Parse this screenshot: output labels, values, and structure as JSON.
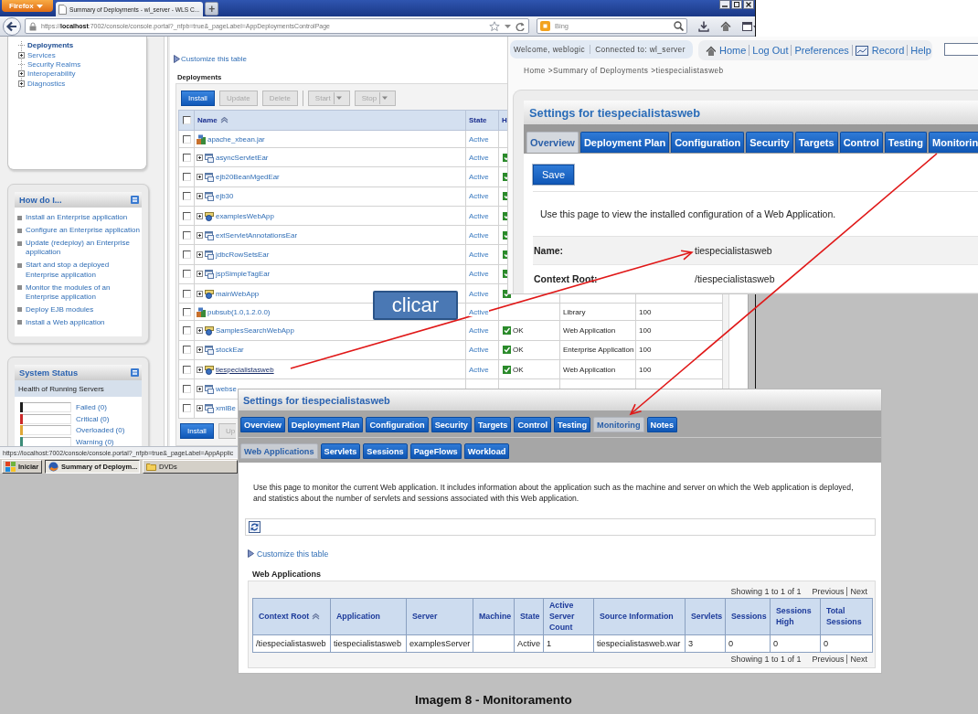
{
  "browser": {
    "menu_button": "Firefox",
    "tab_title": "Summary of Deployments - wl_server - WLS C...",
    "new_tab": "+",
    "url": "https://**localhost**:7002/console/console.portal?_nfpb=true&_pageLabel=AppDeploymentsControlPage",
    "search_placeholder": "Bing",
    "status_url": "https://localhost:7002/console/console.portal?_nfpb=true&_pageLabel=AppApplic"
  },
  "sidebar": {
    "tree": [
      {
        "label": "Deployments",
        "selected": true,
        "expandable": false
      },
      {
        "label": "Services",
        "selected": false,
        "expandable": true
      },
      {
        "label": "Security Realms",
        "selected": false,
        "expandable": false
      },
      {
        "label": "Interoperability",
        "selected": false,
        "expandable": true
      },
      {
        "label": "Diagnostics",
        "selected": false,
        "expandable": true
      }
    ],
    "how_do_i": {
      "title": "How do I...",
      "links": [
        "Install an Enterprise application",
        "Configure an Enterprise application",
        "Update (redeploy) an Enterprise application",
        "Start and stop a deployed Enterprise application",
        "Monitor the modules of an Enterprise application",
        "Deploy EJB modules",
        "Install a Web application"
      ]
    },
    "system_status": {
      "title": "System Status",
      "subtitle": "Health of Running Servers",
      "items": [
        {
          "label": "Failed (0)",
          "color": "#1e1e1e"
        },
        {
          "label": "Critical (0)",
          "color": "#cc2a2a"
        },
        {
          "label": "Overloaded (0)",
          "color": "#e0a838"
        },
        {
          "label": "Warning (0)",
          "color": "#3c8c78"
        }
      ]
    }
  },
  "deployments": {
    "customize_link": "Customize this table",
    "title": "Deployments",
    "all_checked": false,
    "buttons": [
      {
        "label": "Install",
        "disabled": false,
        "dropdown": false
      },
      {
        "label": "Update",
        "disabled": true,
        "dropdown": false
      },
      {
        "label": "Delete",
        "disabled": true,
        "dropdown": false
      },
      {
        "label": "Start",
        "disabled": true,
        "dropdown": true
      },
      {
        "label": "Stop",
        "disabled": true,
        "dropdown": true
      }
    ],
    "columns": [
      {
        "label": "Name",
        "sorted": true
      },
      {
        "label": "State",
        "sorted": false
      },
      {
        "label": "H"
      }
    ],
    "rows": [
      {
        "name": "apache_xbean.jar",
        "kind": "library",
        "state": "Active",
        "checked": false,
        "hovered": false,
        "healthy": false
      },
      {
        "name": "asyncServletEar",
        "kind": "ear",
        "state": "Active",
        "checked": false,
        "hovered": false,
        "healthy": true
      },
      {
        "name": "ejb20BeanMgedEar",
        "kind": "ear",
        "state": "Active",
        "checked": false,
        "hovered": false,
        "healthy": true
      },
      {
        "name": "ejb30",
        "kind": "ear",
        "state": "Active",
        "checked": false,
        "hovered": false,
        "healthy": true
      },
      {
        "name": "examplesWebApp",
        "kind": "webapp",
        "state": "Active",
        "checked": false,
        "hovered": false,
        "healthy": true
      },
      {
        "name": "extServletAnnotationsEar",
        "kind": "ear",
        "state": "Active",
        "checked": false,
        "hovered": false,
        "healthy": true
      },
      {
        "name": "jdbcRowSetsEar",
        "kind": "ear",
        "state": "Active",
        "checked": false,
        "hovered": false,
        "healthy": true
      },
      {
        "name": "jspSimpleTagEar",
        "kind": "ear",
        "state": "Active",
        "checked": false,
        "hovered": false,
        "healthy": true
      },
      {
        "name": "mainWebApp",
        "kind": "webapp",
        "state": "Active",
        "checked": false,
        "hovered": false,
        "healthy": true
      },
      {
        "name": "pubsub(1.0,1.2.0.0)",
        "kind": "library",
        "state": "Active",
        "checked": false,
        "hovered": false,
        "healthy": false,
        "type": "Library",
        "order": "100"
      },
      {
        "name": "SamplesSearchWebApp",
        "kind": "webapp",
        "state": "Active",
        "checked": false,
        "hovered": false,
        "healthy": true,
        "health": "OK",
        "type": "Web Application",
        "order": "100"
      },
      {
        "name": "stockEar",
        "kind": "ear",
        "state": "Active",
        "checked": false,
        "hovered": false,
        "healthy": true,
        "health": "OK",
        "type": "Enterprise Application",
        "order": "100"
      },
      {
        "name": "tiespecialistasweb",
        "kind": "webapp",
        "state": "Active",
        "checked": false,
        "hovered": true,
        "healthy": true,
        "health": "OK",
        "type": "Web Application",
        "order": "100"
      },
      {
        "name": "webse",
        "kind": "ear",
        "checked": false,
        "hovered": false
      },
      {
        "name": "xmlBe",
        "kind": "ear",
        "checked": false,
        "hovered": false
      }
    ],
    "bottom_buttons": [
      {
        "label": "Install",
        "disabled": false
      },
      {
        "label": "Up",
        "disabled": true
      }
    ]
  },
  "taskbar": {
    "start": "Iniciar",
    "items": [
      {
        "label": "Summary of Deploym...",
        "selected": true
      },
      {
        "label": "DVDs",
        "selected": false
      }
    ]
  },
  "callout": "clicar",
  "overview_window": {
    "welcome": "Welcome, weblogic",
    "connected": "Connected to: wl_server",
    "links": [
      "Home",
      "Log Out",
      "Preferences",
      "Record",
      "Help"
    ],
    "breadcrumb": {
      "items": [
        "Home",
        "Summary of Deployments",
        "tiespecialistasweb"
      ],
      "separator": ">"
    },
    "title": "Settings for tiespecialistasweb",
    "tabs": [
      {
        "label": "Overview",
        "selected": true
      },
      {
        "label": "Deployment Plan",
        "selected": false
      },
      {
        "label": "Configuration",
        "selected": false
      },
      {
        "label": "Security",
        "selected": false
      },
      {
        "label": "Targets",
        "selected": false
      },
      {
        "label": "Control",
        "selected": false
      },
      {
        "label": "Testing",
        "selected": false
      },
      {
        "label": "Monitorin",
        "selected": false
      }
    ],
    "save_button": "Save",
    "description": "Use this page to view the installed configuration of a Web Application.",
    "fields": [
      {
        "label": "Name:",
        "value": "tiespecialistasweb"
      },
      {
        "label": "Context Root:",
        "value": "/tiespecialistasweb"
      }
    ]
  },
  "monitoring_window": {
    "title": "Settings for tiespecialistasweb",
    "tabs": [
      {
        "label": "Overview",
        "selected": false
      },
      {
        "label": "Deployment Plan",
        "selected": false
      },
      {
        "label": "Configuration",
        "selected": false
      },
      {
        "label": "Security",
        "selected": false
      },
      {
        "label": "Targets",
        "selected": false
      },
      {
        "label": "Control",
        "selected": false
      },
      {
        "label": "Testing",
        "selected": false
      },
      {
        "label": "Monitoring",
        "selected": true
      },
      {
        "label": "Notes",
        "selected": false
      }
    ],
    "subtabs": [
      {
        "label": "Web Applications",
        "selected": true
      },
      {
        "label": "Servlets",
        "selected": false
      },
      {
        "label": "Sessions",
        "selected": false
      },
      {
        "label": "PageFlows",
        "selected": false
      },
      {
        "label": "Workload",
        "selected": false
      }
    ],
    "description": "Use this page to monitor the current Web application. It includes information about the application such as the machine and server on which the Web application is deployed, and statistics about the number of servlets and sessions associated with this Web application.",
    "customize_link": "Customize this table",
    "table_title": "Web Applications",
    "pagination_top": {
      "summary": "Showing 1 to 1 of 1",
      "previous": "Previous",
      "next": "Next"
    },
    "columns": [
      {
        "label": "Context Root",
        "sorted": true
      },
      {
        "label": "Application",
        "sorted": false
      },
      {
        "label": "Server",
        "sorted": false
      },
      {
        "label": "Machine",
        "sorted": false
      },
      {
        "label": "State",
        "sorted": false
      },
      {
        "label": "Active Server Count",
        "sorted": false
      },
      {
        "label": "Source Information",
        "sorted": false
      },
      {
        "label": "Servlets",
        "sorted": false
      },
      {
        "label": "Sessions",
        "sorted": false
      },
      {
        "label": "Sessions High",
        "sorted": false
      },
      {
        "label": "Total Sessions",
        "sorted": false
      }
    ],
    "rows": [
      [
        "/tiespecialistasweb",
        "tiespecialistasweb",
        "examplesServer",
        null,
        "Active",
        "1",
        "tiespecialistasweb.war",
        "3",
        "0",
        "0",
        "0"
      ]
    ],
    "pagination_bottom": {
      "summary": "Showing 1 to 1 of 1",
      "previous": "Previous",
      "next": "Next"
    }
  },
  "caption": "Imagem 8 - Monitoramento"
}
